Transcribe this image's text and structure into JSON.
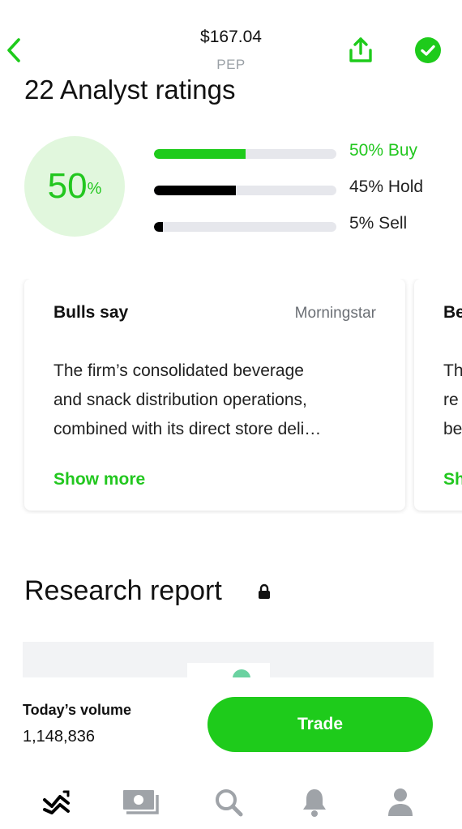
{
  "header": {
    "price": "$167.04",
    "ticker": "PEP",
    "back_icon": "chevron-left-icon",
    "share_icon": "share-icon",
    "check_icon": "check-circle-icon"
  },
  "ratings": {
    "title": "22 Analyst ratings",
    "summary_percent": "50",
    "summary_symbol": "%",
    "bars": [
      {
        "label": "50% Buy",
        "fraction": 0.5,
        "color": "#1ecb1b"
      },
      {
        "label": "45% Hold",
        "fraction": 0.45,
        "color": "#000000"
      },
      {
        "label": "5% Sell",
        "fraction": 0.05,
        "color": "#000000"
      }
    ]
  },
  "cards": [
    {
      "title": "Bulls say",
      "source": "Morningstar",
      "body_lines": [
        "The firm’s consolidated beverage",
        "and snack distribution operations,",
        "combined with its direct store deli…"
      ],
      "more_label": "Show more"
    },
    {
      "title": "Be",
      "body_lines": [
        "Th",
        "re",
        "be"
      ],
      "more_label": "Sh"
    }
  ],
  "research": {
    "title": "Research report",
    "lock_icon": "lock-icon"
  },
  "volume": {
    "label": "Today’s volume",
    "value": "1,148,836"
  },
  "trade_label": "Trade",
  "tabs": [
    {
      "name": "tab-investing",
      "icon": "chart-icon",
      "active": true
    },
    {
      "name": "tab-browse",
      "icon": "money-icon",
      "active": false
    },
    {
      "name": "tab-search",
      "icon": "search-icon",
      "active": false
    },
    {
      "name": "tab-notifications",
      "icon": "bell-icon",
      "active": false
    },
    {
      "name": "tab-account",
      "icon": "person-icon",
      "active": false
    }
  ],
  "colors": {
    "accent": "#1ecb1b",
    "accent_light": "#e1f7dd",
    "track": "#e6e7ec",
    "inactive_icon": "#9fa3a8"
  }
}
